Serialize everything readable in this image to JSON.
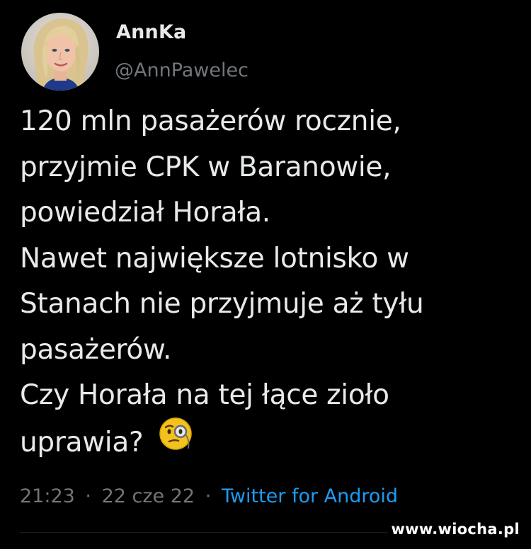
{
  "tweet": {
    "author": {
      "display_name": "AnnKa",
      "handle": "@AnnPawelec"
    },
    "text_lines": [
      "120 mln pasażerów rocznie,",
      "przyjmie CPK w Baranowie,",
      "powiedział Horała.",
      "Nawet największe lotnisko w",
      "Stanach nie przyjmuje aż tyłu",
      "pasażerów.",
      "Czy Horała na tej łące zioło",
      "uprawia?"
    ],
    "emoji": "face-with-monocle-icon",
    "time": "21:23",
    "date": "22 cze 22",
    "separator": "·",
    "source": "Twitter for Android"
  },
  "watermark": "www.wiocha.pl",
  "colors": {
    "background": "#000000",
    "primary_text": "#e7e9ea",
    "secondary_text": "#71767b",
    "link": "#1d9bf0",
    "emoji_yellow": "#f4c21f"
  }
}
